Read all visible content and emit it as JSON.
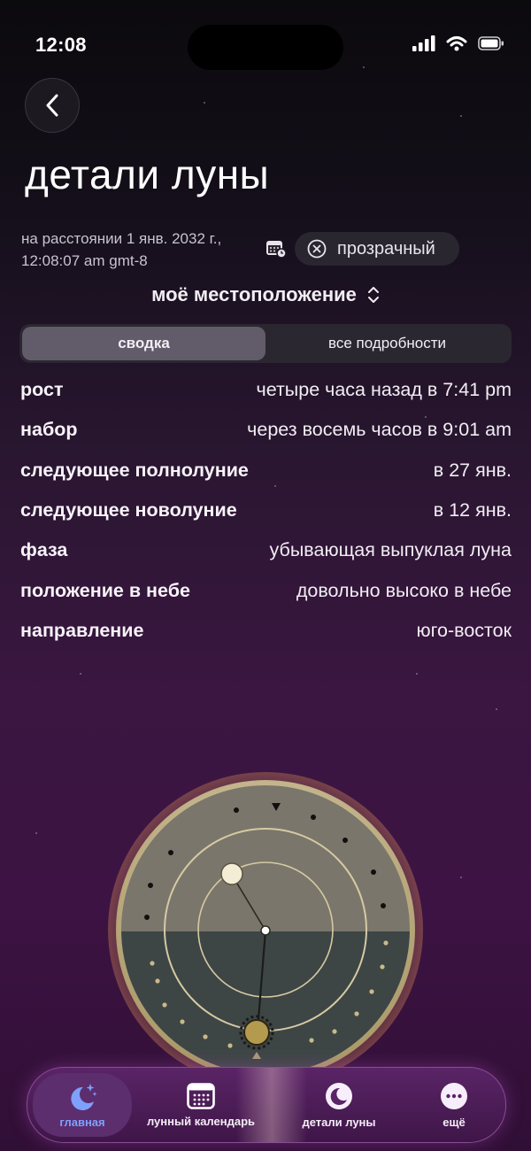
{
  "status_bar": {
    "time": "12:08"
  },
  "header": {
    "title": "детали луны"
  },
  "distance": {
    "line1": "на расстоянии 1 янв. 2032 г.,",
    "line2": "12:08:07 am gmt-8"
  },
  "visibility": {
    "label": "прозрачный"
  },
  "location": {
    "label": "моё местоположение"
  },
  "segments": {
    "summary": "сводка",
    "details": "все подробности",
    "active": "summary"
  },
  "info": [
    {
      "label": "рост",
      "value": "четыре часа назад в 7:41 pm"
    },
    {
      "label": "набор",
      "value": "через восемь часов в 9:01 am"
    },
    {
      "label": "следующее полнолуние",
      "value": "в 27 янв."
    },
    {
      "label": "следующее новолуние",
      "value": "в 12 янв."
    },
    {
      "label": "фаза",
      "value": "убывающая выпуклая луна"
    },
    {
      "label": "положение в небе",
      "value": "довольно высоко в небе"
    },
    {
      "label": "направление",
      "value": "юго-восток"
    }
  ],
  "nav": {
    "items": [
      {
        "label": "главная",
        "icon": "moon-stars-icon",
        "active": true
      },
      {
        "label": "лунный календарь",
        "icon": "calendar-icon",
        "active": false
      },
      {
        "label": "детали луны",
        "icon": "moon-icon",
        "active": false
      },
      {
        "label": "ещё",
        "icon": "more-icon",
        "active": false
      }
    ]
  },
  "colors": {
    "background_top": "#0b0a0d",
    "background_bottom": "#3d1343",
    "dial_sky": "#7a766b",
    "dial_ground": "#3d4645",
    "accent_active_tab": "#7fa0ff"
  }
}
